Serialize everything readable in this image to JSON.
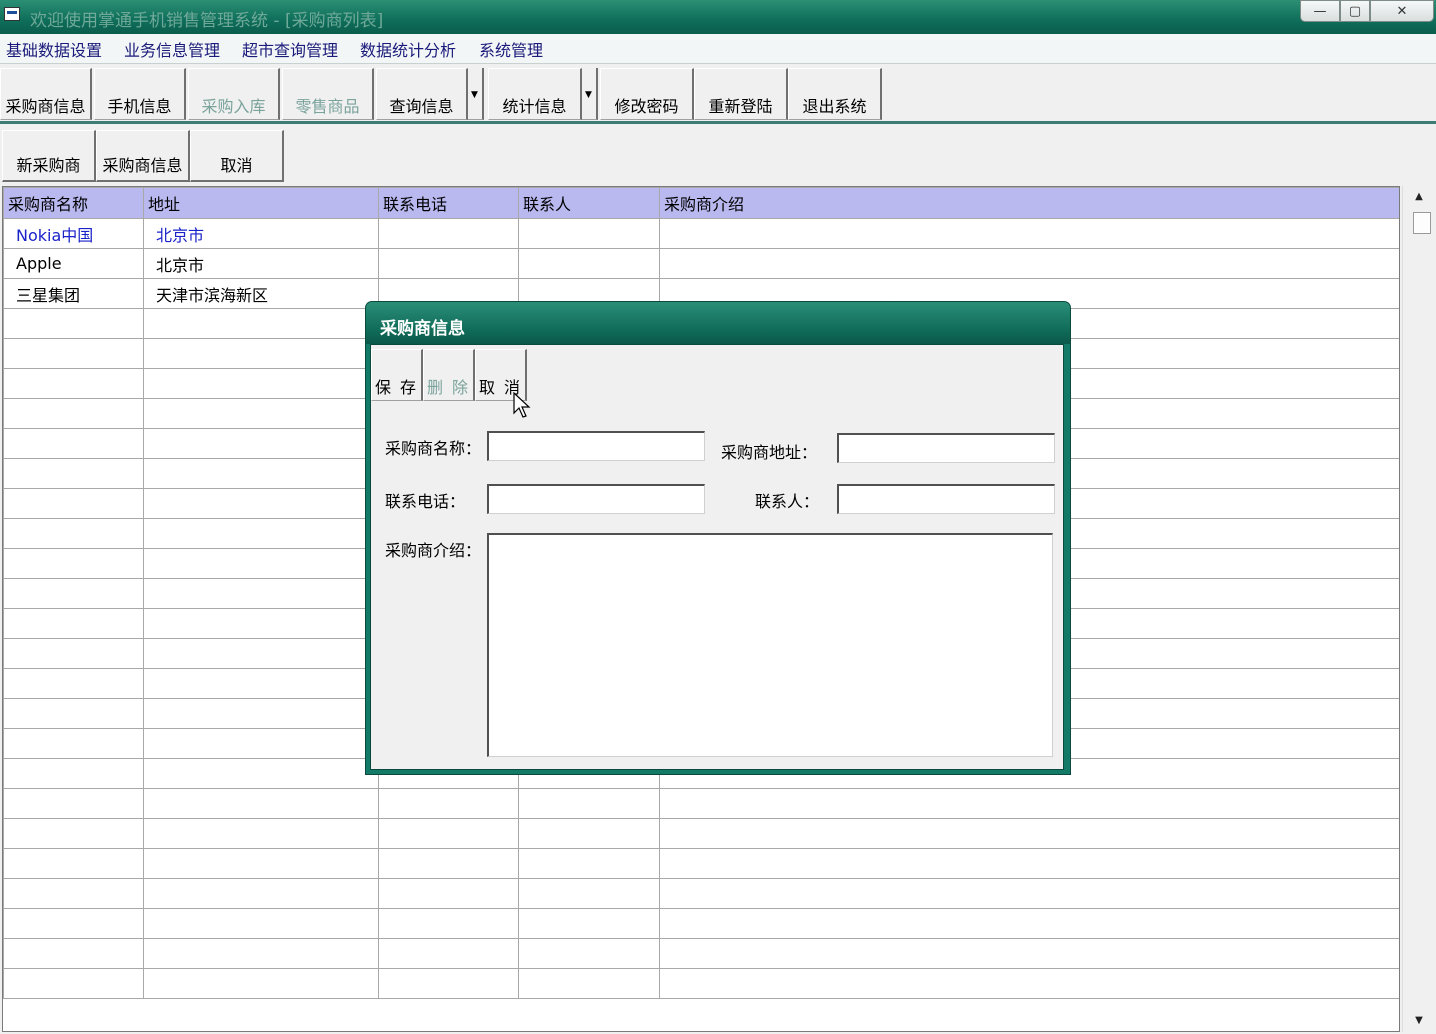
{
  "window": {
    "title": "欢迎使用掌通手机销售管理系统 - [采购商列表]",
    "controls": {
      "minimize": "—",
      "maximize": "▢",
      "close": "✕"
    }
  },
  "menu": [
    {
      "label": "基础数据设置"
    },
    {
      "label": "业务信息管理"
    },
    {
      "label": "超市查询管理"
    },
    {
      "label": "数据统计分析"
    },
    {
      "label": "系统管理"
    }
  ],
  "toolbar": [
    {
      "label": "采购商信息",
      "enabled": true
    },
    {
      "label": "手机信息",
      "enabled": true
    },
    {
      "label": "采购入库",
      "enabled": false
    },
    {
      "label": "零售商品",
      "enabled": false
    },
    {
      "label": "查询信息",
      "enabled": true,
      "dropdown": true
    },
    {
      "label": "统计信息",
      "enabled": true,
      "dropdown": true
    },
    {
      "label": "修改密码",
      "enabled": true
    },
    {
      "label": "重新登陆",
      "enabled": true
    },
    {
      "label": "退出系统",
      "enabled": true
    }
  ],
  "subtoolbar": [
    {
      "label": "新采购商"
    },
    {
      "label": "采购商信息"
    },
    {
      "label": "取消"
    }
  ],
  "grid": {
    "columns": [
      "采购商名称",
      "地址",
      "联系电话",
      "联系人",
      "采购商介绍"
    ],
    "rows": [
      [
        "Nokia中国",
        "北京市",
        "",
        "",
        ""
      ],
      [
        "Apple",
        "北京市",
        "",
        "",
        ""
      ],
      [
        "三星集团",
        "天津市滨海新区",
        "",
        "",
        ""
      ]
    ],
    "selected_row": 0,
    "empty_rows": 23
  },
  "dialog": {
    "title": "采购商信息",
    "buttons": [
      {
        "label": "保 存",
        "enabled": true
      },
      {
        "label": "删 除",
        "enabled": false
      },
      {
        "label": "取 消",
        "enabled": true
      }
    ],
    "fields": {
      "name_label": "采购商名称：",
      "name_value": "",
      "address_label": "采购商地址：",
      "address_value": "",
      "phone_label": "联系电话：",
      "phone_value": "",
      "contact_label": "联系人：",
      "contact_value": "",
      "intro_label": "采购商介绍：",
      "intro_value": ""
    }
  },
  "colors": {
    "titlebar": "#0e6e5a",
    "grid_header": "#b9b9f0",
    "selected_text": "#1a22c8",
    "disabled_text": "#7aa39c"
  }
}
